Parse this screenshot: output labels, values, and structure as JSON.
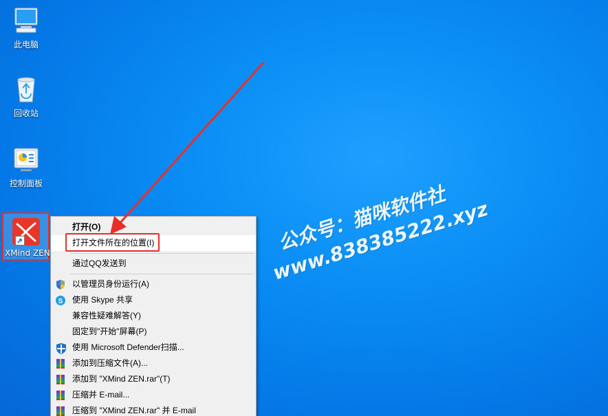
{
  "desktop": {
    "icons": {
      "pc": "此电脑",
      "recycle": "回收站",
      "control": "控制面板",
      "xmind": "XMind ZEN"
    }
  },
  "context_menu": {
    "items": {
      "open": "打开(O)",
      "open_location": "打开文件所在的位置(I)",
      "send_qq": "通过QQ发送到",
      "run_admin": "以管理员身份运行(A)",
      "skype_share": "使用 Skype 共享",
      "compat": "兼容性疑难解答(Y)",
      "pin_start": "固定到\"开始\"屏幕(P)",
      "defender": "使用 Microsoft Defender扫描...",
      "add_archive": "添加到压缩文件(A)...",
      "add_rar": "添加到 \"XMind ZEN.rar\"(T)",
      "compress_email": "压缩并 E-mail...",
      "compress_rar_email": "压缩到 \"XMind ZEN.rar\" 并 E-mail"
    }
  },
  "watermark": {
    "line1": "公众号：猫咪软件社",
    "line2": "www.838385222.xyz"
  },
  "colors": {
    "accent_red": "#e8302a",
    "desktop_blue": "#0a8ef5"
  }
}
